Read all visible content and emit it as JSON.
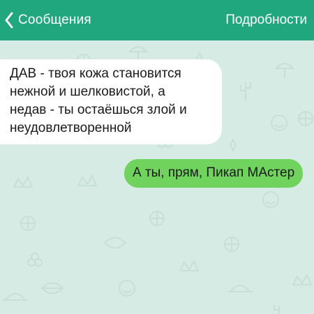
{
  "header": {
    "back_label": "Сообщения",
    "details_label": "Подробности",
    "bar_color": "#21a77e"
  },
  "messages": [
    {
      "direction": "incoming",
      "lines": [
        "ДАВ - твоя кожа становится",
        "нежной и шелковистой, а",
        "недав - ты остаёшься злой и",
        "неудовлетворенной"
      ],
      "bubble_color": "#ffffff"
    },
    {
      "direction": "outgoing",
      "lines": [
        "А ты, прям, Пикап МАстер"
      ],
      "bubble_color": "#6fd35e"
    }
  ],
  "background": {
    "color": "#d6ebe3",
    "pattern_icons": [
      "basketball-icon",
      "clover-icon",
      "crown-icon",
      "smiley-icon",
      "umbrella-icon",
      "cactus-icon",
      "leaf-icon",
      "food-tray-icon"
    ]
  }
}
